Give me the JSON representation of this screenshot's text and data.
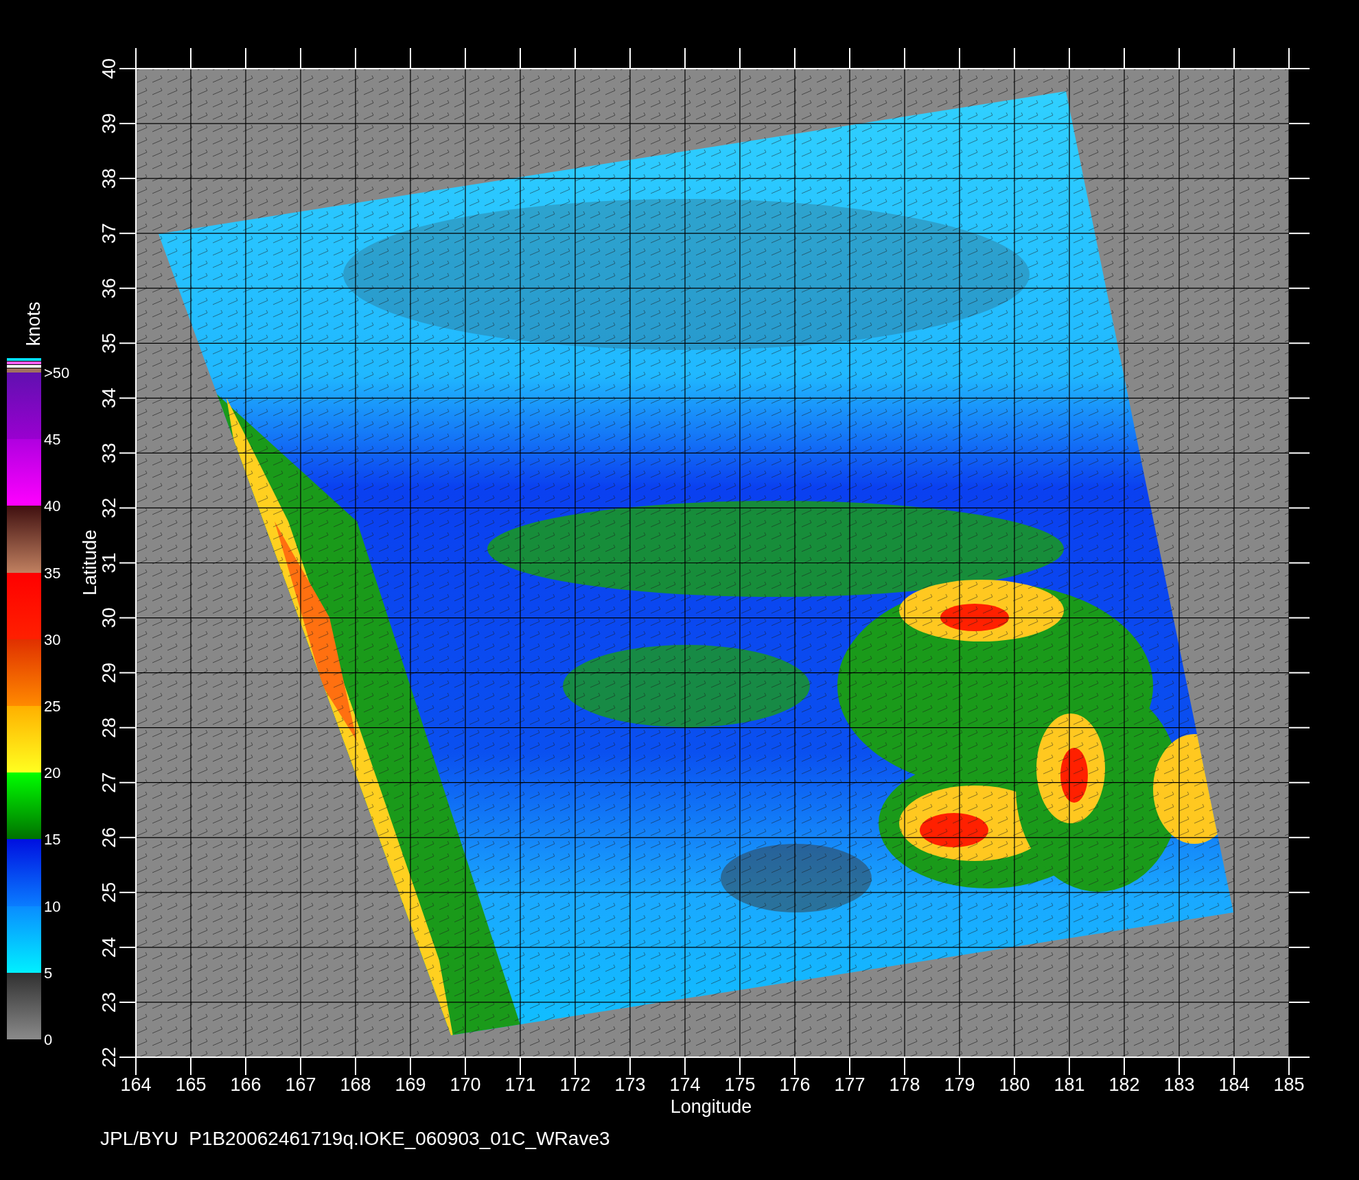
{
  "y_axis": {
    "label": "Latitude",
    "ticks": [
      "22",
      "23",
      "24",
      "25",
      "26",
      "27",
      "28",
      "29",
      "30",
      "31",
      "32",
      "33",
      "34",
      "35",
      "36",
      "37",
      "38",
      "39",
      "40"
    ]
  },
  "x_axis": {
    "label": "Longitude",
    "ticks": [
      "164",
      "165",
      "166",
      "167",
      "168",
      "169",
      "170",
      "171",
      "172",
      "173",
      "174",
      "175",
      "176",
      "177",
      "178",
      "179",
      "180",
      "181",
      "182",
      "183",
      "184",
      "185"
    ]
  },
  "colorbar": {
    "unit": "knots",
    "labels": [
      ">50",
      "45",
      "40",
      "35",
      "30",
      "25",
      "20",
      "15",
      "10",
      "5",
      "0"
    ]
  },
  "footer": "JPL/BYU  P1B20062461719q.IOKE_060903_01C_WRave3"
}
